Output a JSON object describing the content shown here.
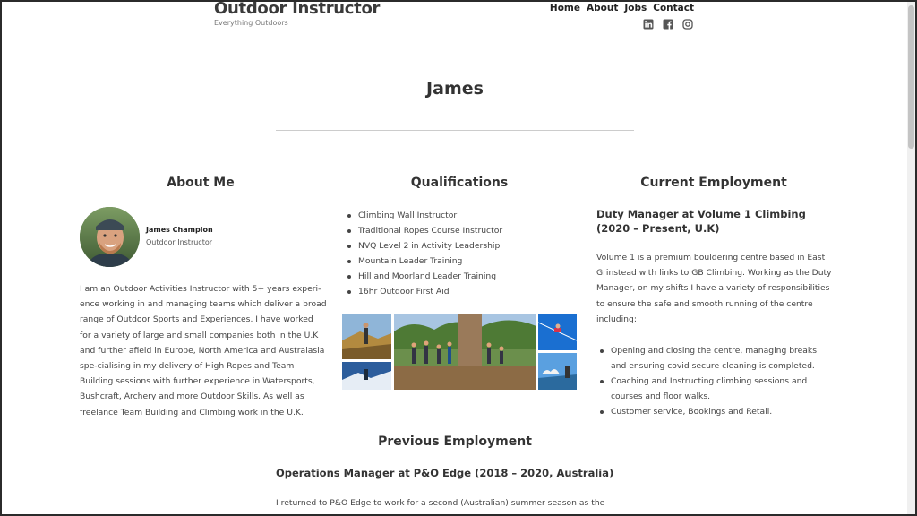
{
  "site": {
    "title": "Outdoor Instructor",
    "tagline": "Everything Outdoors"
  },
  "nav": [
    {
      "label": "Home"
    },
    {
      "label": "About"
    },
    {
      "label": "Jobs"
    },
    {
      "label": "Contact"
    }
  ],
  "social": [
    "linkedin-icon",
    "facebook-icon",
    "instagram-icon"
  ],
  "page": {
    "title": "James"
  },
  "about": {
    "heading": "About Me",
    "author_name": "James Champion",
    "author_role": "Outdoor Instructor",
    "bio": "I am an Outdoor Activities Instructor with 5+ years experi-ence working in and managing teams which deliver a broad range of Outdoor Sports and Experiences. I have worked for a variety of large and small companies both in the U.K and further afield in Europe, North America and Australasia spe-cialising in my delivery of High Ropes and Team Building sessions with further experience in Watersports, Bushcraft, Archery and more Outdoor Skills. As well as freelance Team Building and Climbing work in the U.K."
  },
  "qualifications": {
    "heading": "Qualifications",
    "items": [
      "Climbing Wall Instructor",
      "Traditional Ropes Course Instructor",
      "NVQ Level 2 in Activity Leadership",
      "Mountain Leader Training",
      "Hill and Moorland Leader Training",
      "16hr Outdoor First Aid"
    ]
  },
  "current": {
    "heading": "Current Employment",
    "job_title": "Duty Manager at Volume 1 Climbing (2020 – Present, U.K)",
    "description": "Volume 1 is a premium bouldering centre based in East Grinstead with links to GB Climbing. Working as the Duty Manager, on my shifts I have a variety of responsibilities to ensure the safe and smooth running of the centre including:",
    "items": [
      "Opening and closing the centre, managing breaks and ensuring covid secure cleaning is completed.",
      "Coaching and Instructing climbing sessions and courses and floor walks.",
      "Customer service, Bookings and Retail."
    ]
  },
  "previous": {
    "heading": "Previous Employment",
    "job_title": "Operations Manager at P&O Edge (2018 – 2020, Australia)",
    "description": "I returned to P&O Edge to work for a second (Australian) summer season as the"
  }
}
